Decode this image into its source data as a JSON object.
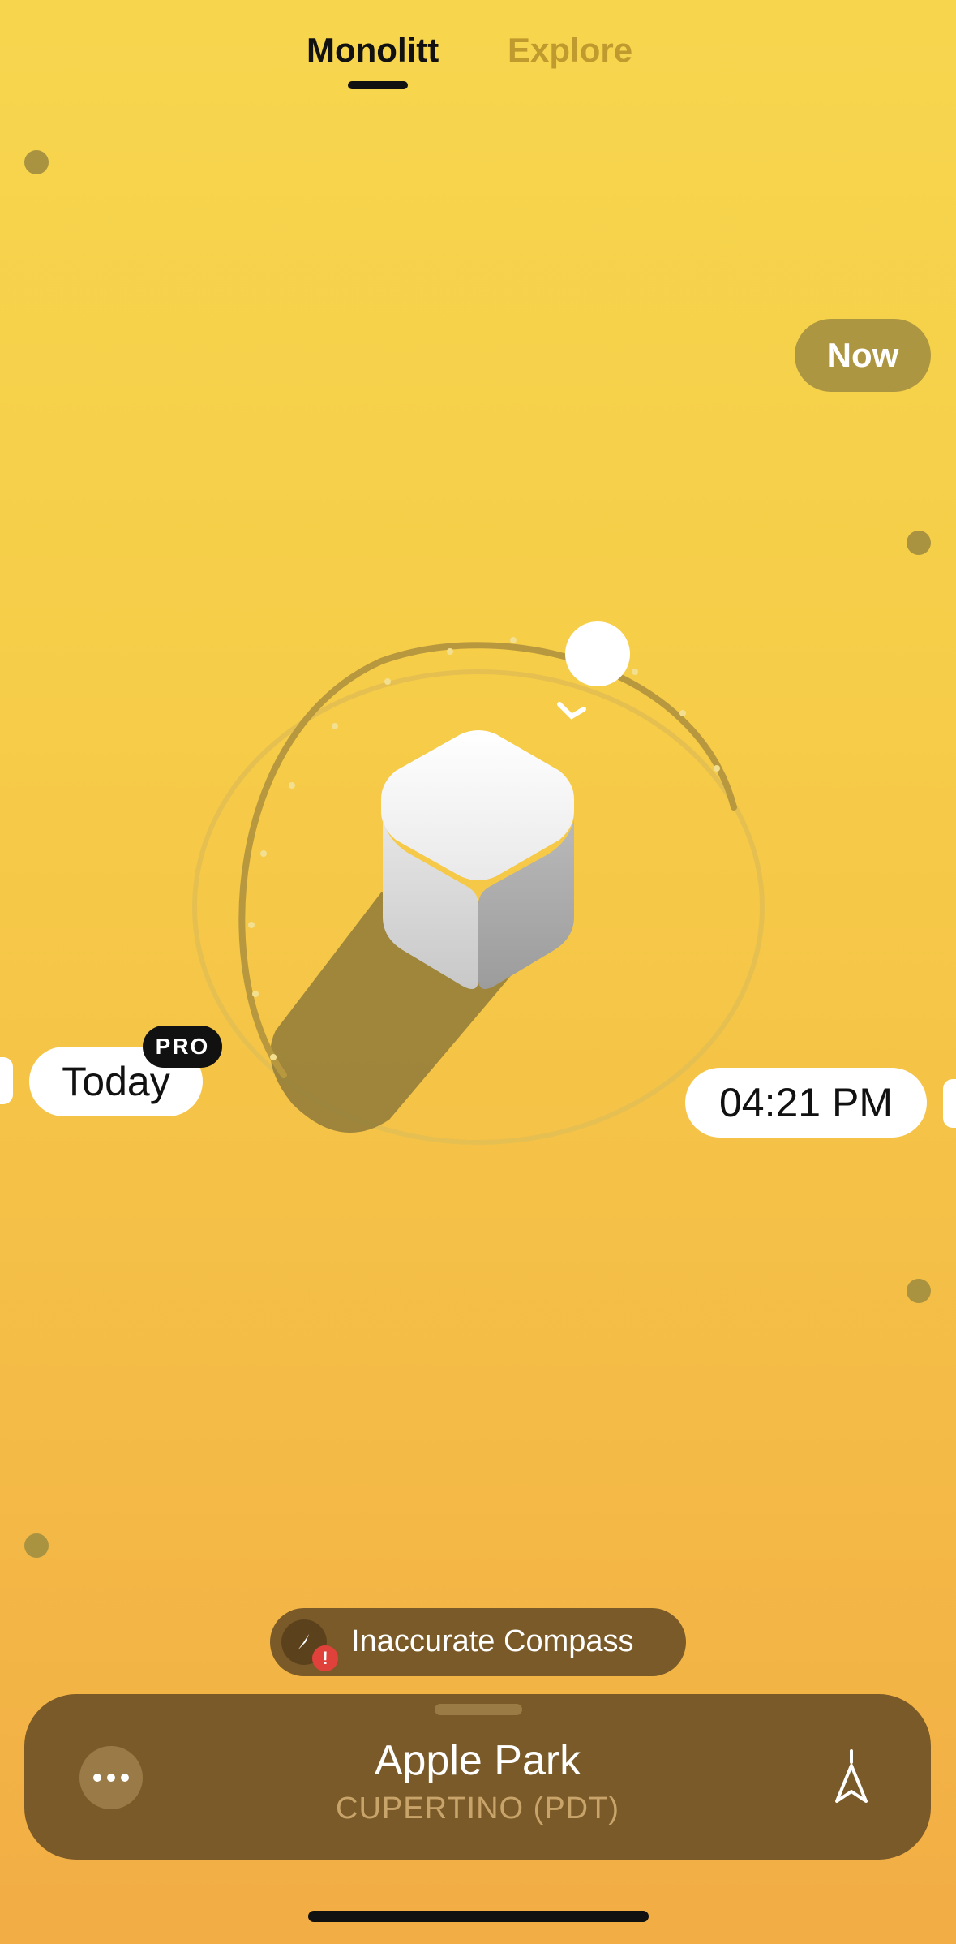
{
  "tabs": {
    "active": "Monolitt",
    "inactive": "Explore"
  },
  "now_label": "Now",
  "today_label": "Today",
  "pro_badge": "PRO",
  "time_label": "04:21 PM",
  "compass_warning": {
    "text": "Inaccurate Compass",
    "alert": "!"
  },
  "location": {
    "name": "Apple Park",
    "subtitle": "CUPERTINO (PDT)"
  },
  "colors": {
    "background_top": "#f7d64e",
    "background_bottom": "#f2ad45",
    "card": "#7a5a28",
    "pill_now": "#ad9642",
    "alert": "#e0413a"
  }
}
